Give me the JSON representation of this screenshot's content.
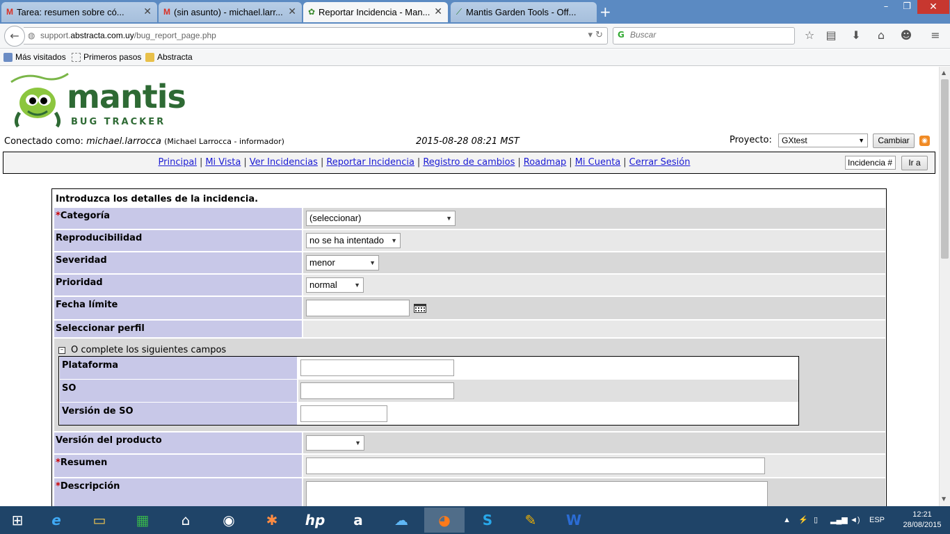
{
  "browser": {
    "tabs": [
      {
        "title": "Tarea: resumen sobre có...",
        "favicon": "gmail-icon"
      },
      {
        "title": "(sin asunto) - michael.larr...",
        "favicon": "gmail-icon"
      },
      {
        "title": "Reportar Incidencia - Man...",
        "favicon": "mantis-icon",
        "active": true
      },
      {
        "title": "Mantis Garden Tools - Off...",
        "favicon": "mantis-tools-icon"
      }
    ],
    "url_prefix": "support.",
    "url_host": "abstracta.com.uy",
    "url_path": "/bug_report_page.php",
    "search_placeholder": "Buscar",
    "bookmarks": [
      "Más visitados",
      "Primeros pasos",
      "Abstracta"
    ]
  },
  "header": {
    "logo_word": "mantis",
    "logo_sub": "BUG TRACKER",
    "logged_label": "Conectado como:",
    "username": "michael.larrocca",
    "user_detail": "(Michael Larrocca - informador)",
    "datetime": "2015-08-28 08:21 MST",
    "project_label": "Proyecto:",
    "project_value": "GXtest",
    "change_button": "Cambiar"
  },
  "menu": {
    "items": [
      "Principal",
      "Mi Vista",
      "Ver Incidencias",
      "Reportar Incidencia",
      "Registro de cambios",
      "Roadmap",
      "Mi Cuenta",
      "Cerrar Sesión"
    ],
    "issue_placeholder": "Incidencia #",
    "goto_button": "Ir a"
  },
  "form": {
    "title": "Introduzca los detalles de la incidencia.",
    "required_mark": "*",
    "categoria_label": "Categoría",
    "categoria_value": "(seleccionar)",
    "reproducibilidad_label": "Reproducibilidad",
    "reproducibilidad_value": "no se ha intentado",
    "severidad_label": "Severidad",
    "severidad_value": "menor",
    "prioridad_label": "Prioridad",
    "prioridad_value": "normal",
    "fecha_label": "Fecha límite",
    "fecha_value": "",
    "perfil_label": "Seleccionar perfil",
    "subsection_title": "O complete los siguientes campos",
    "plataforma_label": "Plataforma",
    "so_label": "SO",
    "version_so_label": "Versión de SO",
    "version_producto_label": "Versión del producto",
    "version_producto_value": "",
    "resumen_label": "Resumen",
    "descripcion_label": "Descripción"
  },
  "taskbar": {
    "language": "ESP",
    "time": "12:21",
    "date": "28/08/2015"
  }
}
